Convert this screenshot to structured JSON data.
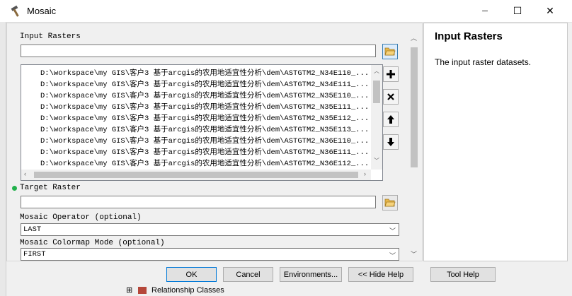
{
  "window": {
    "title": "Mosaic",
    "minimize": "─",
    "maximize": "☐",
    "close": "✕"
  },
  "input_rasters": {
    "label": "Input Rasters",
    "value": "",
    "items": [
      "D:\\workspace\\my GIS\\客户3 基于arcgis的农用地适宜性分析\\dem\\ASTGTM2_N34E110_...",
      "D:\\workspace\\my GIS\\客户3 基于arcgis的农用地适宜性分析\\dem\\ASTGTM2_N34E111_...",
      "D:\\workspace\\my GIS\\客户3 基于arcgis的农用地适宜性分析\\dem\\ASTGTM2_N35E110_...",
      "D:\\workspace\\my GIS\\客户3 基于arcgis的农用地适宜性分析\\dem\\ASTGTM2_N35E111_...",
      "D:\\workspace\\my GIS\\客户3 基于arcgis的农用地适宜性分析\\dem\\ASTGTM2_N35E112_...",
      "D:\\workspace\\my GIS\\客户3 基于arcgis的农用地适宜性分析\\dem\\ASTGTM2_N35E113_...",
      "D:\\workspace\\my GIS\\客户3 基于arcgis的农用地适宜性分析\\dem\\ASTGTM2_N36E110_...",
      "D:\\workspace\\my GIS\\客户3 基于arcgis的农用地适宜性分析\\dem\\ASTGTM2_N36E111_...",
      "D:\\workspace\\my GIS\\客户3 基于arcgis的农用地适宜性分析\\dem\\ASTGTM2_N36E112_..."
    ]
  },
  "target_raster": {
    "label": "Target Raster",
    "value": ""
  },
  "mosaic_operator": {
    "label": "Mosaic Operator (optional)",
    "value": "LAST"
  },
  "colormap_mode": {
    "label": "Mosaic Colormap Mode (optional)",
    "value": "FIRST"
  },
  "help": {
    "title": "Input Rasters",
    "text": "The input raster datasets."
  },
  "buttons": {
    "ok": "OK",
    "cancel": "Cancel",
    "environments": "Environments...",
    "hide_help": "<< Hide Help",
    "tool_help": "Tool Help"
  },
  "background": {
    "tree_item": "Relationship Classes",
    "expander": "⊞"
  },
  "colors": {
    "accent": "#0078d7",
    "required_dot": "#22b14c"
  }
}
